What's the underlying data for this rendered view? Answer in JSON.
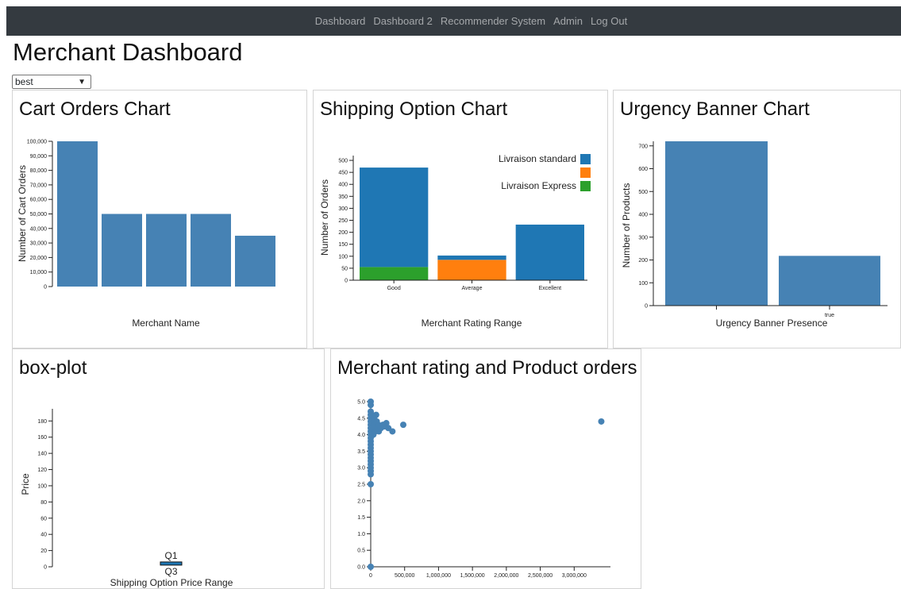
{
  "navbar": {
    "links": [
      "Dashboard",
      "Dashboard 2",
      "Recommender System",
      "Admin",
      "Log Out"
    ]
  },
  "page": {
    "title": "Merchant Dashboard",
    "filter_select": {
      "value": "best"
    }
  },
  "panels": {
    "cart_orders": {
      "title": "Cart Orders Chart"
    },
    "shipping": {
      "title": "Shipping Option Chart"
    },
    "urgency": {
      "title": "Urgency Banner Chart"
    },
    "boxplot": {
      "title": "box-plot"
    },
    "scatter": {
      "title": "Merchant rating and Product orders"
    }
  },
  "colors": {
    "bar": "#4682b4",
    "standard": "#1f77b4",
    "orange": "#ff7f0e",
    "express": "#2ca02c",
    "navbar": "#343a40"
  },
  "chart_data": [
    {
      "id": "cart_orders",
      "type": "bar",
      "xlabel": "Merchant Name",
      "ylabel": "Number of Cart Orders",
      "categories": [
        "",
        "",
        "",
        "",
        ""
      ],
      "values": [
        100000,
        50000,
        50000,
        50000,
        35000
      ],
      "ylim": [
        0,
        100000
      ],
      "yticks": [
        0,
        10000,
        20000,
        30000,
        40000,
        50000,
        60000,
        70000,
        80000,
        90000,
        100000
      ],
      "ytick_labels": [
        "0",
        "10,000",
        "20,000",
        "30,000",
        "40,000",
        "50,000",
        "60,000",
        "70,000",
        "80,000",
        "90,000",
        "100,000"
      ]
    },
    {
      "id": "shipping",
      "type": "bar",
      "stacked": true,
      "xlabel": "Merchant Rating Range",
      "ylabel": "Number of Orders",
      "categories": [
        "Good",
        "Average",
        "Excellent"
      ],
      "series": [
        {
          "name": "Livraison Express",
          "color_key": "express",
          "values": [
            55,
            0,
            0
          ]
        },
        {
          "name": "",
          "color_key": "orange",
          "values": [
            0,
            85,
            0
          ]
        },
        {
          "name": "Livraison standard",
          "color_key": "standard",
          "values": [
            415,
            18,
            232
          ]
        }
      ],
      "legend": [
        "Livraison standard",
        "",
        "Livraison Express"
      ],
      "legend_placement": "top-right",
      "ylim": [
        0,
        520
      ],
      "yticks": [
        0,
        50,
        100,
        150,
        200,
        250,
        300,
        350,
        400,
        450,
        500
      ]
    },
    {
      "id": "urgency",
      "type": "bar",
      "xlabel": "Urgency Banner Presence",
      "ylabel": "Number of Products",
      "categories": [
        "",
        "true"
      ],
      "values": [
        728,
        218
      ],
      "ylim": [
        0,
        720
      ],
      "yticks": [
        0,
        100,
        200,
        300,
        400,
        500,
        600,
        700
      ]
    },
    {
      "id": "boxplot",
      "type": "box",
      "xlabel": "Shipping Option Price Range",
      "ylabel": "Price",
      "annotations": [
        "Q1",
        "Q3"
      ],
      "box": {
        "q1": 2,
        "q3": 4
      },
      "ylim": [
        0,
        195
      ],
      "yticks": [
        0,
        20,
        40,
        60,
        80,
        100,
        120,
        140,
        160,
        180
      ]
    },
    {
      "id": "scatter",
      "type": "scatter",
      "xlabel": "",
      "ylabel": "",
      "xlim": [
        0,
        3500000
      ],
      "ylim": [
        0,
        5
      ],
      "xticks": [
        0,
        500000,
        1000000,
        1500000,
        2000000,
        2500000,
        3000000
      ],
      "xtick_labels": [
        "0",
        "500,000",
        "1,000,000",
        "1,500,000",
        "2,000,000",
        "2,500,000",
        "3,000,000"
      ],
      "yticks": [
        0,
        0.5,
        1.0,
        1.5,
        2.0,
        2.5,
        3.0,
        3.5,
        4.0,
        4.5,
        5.0
      ],
      "ytick_labels": [
        "0.0",
        "0.5",
        "1.0",
        "1.5",
        "2.0",
        "2.5",
        "3.0",
        "3.5",
        "4.0",
        "4.5",
        "5.0"
      ],
      "points": [
        [
          0,
          5.0
        ],
        [
          0,
          4.9
        ],
        [
          0,
          4.7
        ],
        [
          0,
          4.6
        ],
        [
          0,
          4.5
        ],
        [
          0,
          4.4
        ],
        [
          0,
          4.3
        ],
        [
          0,
          4.2
        ],
        [
          0,
          4.1
        ],
        [
          0,
          4.0
        ],
        [
          0,
          3.9
        ],
        [
          0,
          3.8
        ],
        [
          0,
          3.7
        ],
        [
          0,
          3.6
        ],
        [
          0,
          3.5
        ],
        [
          0,
          3.4
        ],
        [
          0,
          3.3
        ],
        [
          0,
          3.2
        ],
        [
          0,
          3.1
        ],
        [
          0,
          3.0
        ],
        [
          0,
          2.9
        ],
        [
          0,
          2.8
        ],
        [
          0,
          2.5
        ],
        [
          0,
          0
        ],
        [
          20000,
          4.6
        ],
        [
          25000,
          4.4
        ],
        [
          30000,
          4.2
        ],
        [
          40000,
          4.0
        ],
        [
          50000,
          4.5
        ],
        [
          60000,
          4.3
        ],
        [
          70000,
          4.1
        ],
        [
          80000,
          4.6
        ],
        [
          90000,
          4.4
        ],
        [
          100000,
          4.2
        ],
        [
          110000,
          4.3
        ],
        [
          120000,
          4.1
        ],
        [
          150000,
          4.2
        ],
        [
          180000,
          4.3
        ],
        [
          200000,
          4.25
        ],
        [
          230000,
          4.35
        ],
        [
          260000,
          4.2
        ],
        [
          320000,
          4.1
        ],
        [
          480000,
          4.3
        ],
        [
          3400000,
          4.4
        ]
      ]
    }
  ]
}
